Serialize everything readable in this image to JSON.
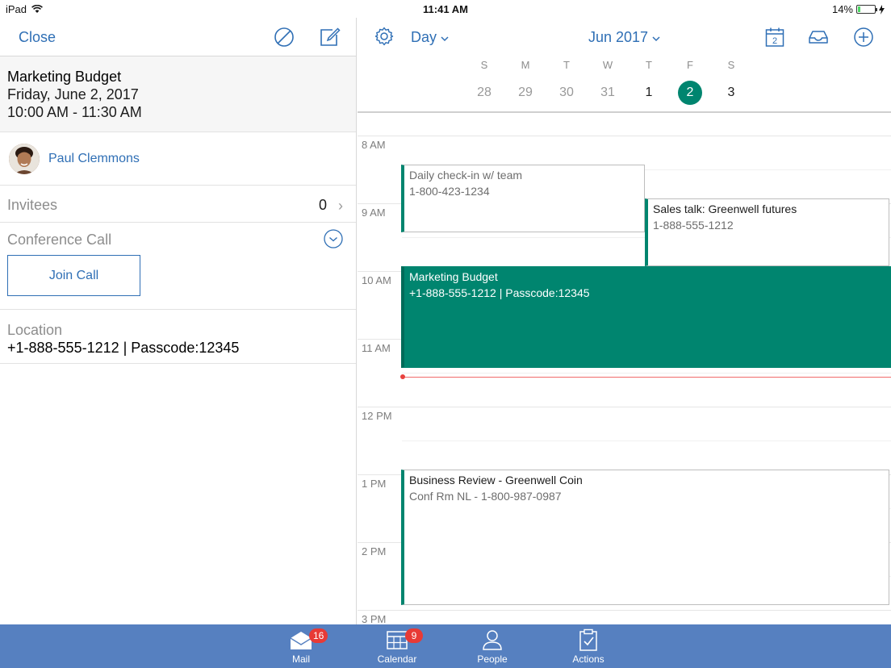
{
  "status_bar": {
    "device": "iPad",
    "time": "11:41 AM",
    "battery": "14%",
    "battery_level": 0.14
  },
  "detail": {
    "close_label": "Close",
    "title": "Marketing Budget",
    "date": "Friday, June 2, 2017",
    "time_range": "10:00 AM - 11:30 AM",
    "organizer": "Paul Clemmons",
    "invitees_label": "Invitees",
    "invitees_count": "0",
    "conference_label": "Conference Call",
    "join_label": "Join Call",
    "location_label": "Location",
    "location_value": "+1-888-555-1212 | Passcode:12345"
  },
  "calendar": {
    "view": "Day",
    "month": "Jun 2017",
    "weekday_letters": [
      "S",
      "M",
      "T",
      "W",
      "T",
      "F",
      "S"
    ],
    "dates": [
      "28",
      "29",
      "30",
      "31",
      "1",
      "2",
      "3"
    ],
    "selected_index": 5,
    "today_icon_number": "2",
    "hours": [
      "8 AM",
      "9 AM",
      "10 AM",
      "11 AM",
      "12 PM",
      "1 PM",
      "2 PM",
      "3 PM"
    ],
    "events": [
      {
        "title": "Daily check-in w/ team",
        "subtitle": "1-800-423-1234"
      },
      {
        "title": "Sales talk: Greenwell futures",
        "subtitle": "1-888-555-1212"
      },
      {
        "title": "Marketing Budget",
        "subtitle": "+1-888-555-1212 | Passcode:12345"
      },
      {
        "title": "Business Review - Greenwell Coin",
        "subtitle": "Conf Rm NL - 1-800-987-0987"
      }
    ]
  },
  "tabs": [
    {
      "label": "Mail",
      "badge": "16"
    },
    {
      "label": "Calendar",
      "badge": "9"
    },
    {
      "label": "People"
    },
    {
      "label": "Actions"
    }
  ],
  "colors": {
    "accent": "#2f6fb5",
    "event": "#00856f",
    "tabbar": "#5680c0",
    "badge": "#e83a36",
    "now": "#e8413e"
  }
}
